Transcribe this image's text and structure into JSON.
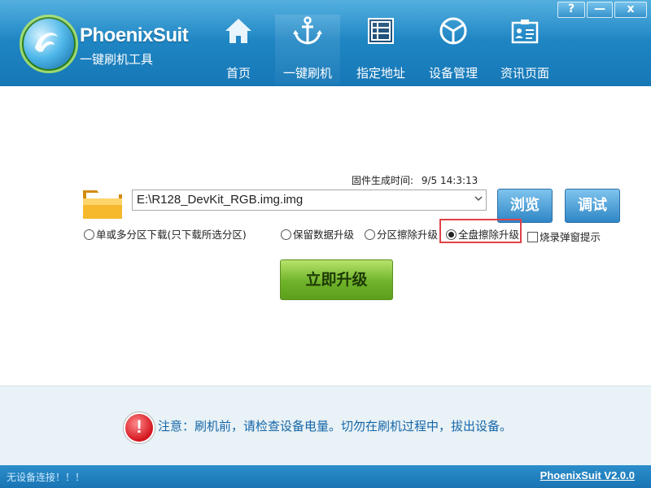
{
  "app": {
    "title": "PhoenixSuit",
    "subtitle": "一键刷机工具"
  },
  "window_controls": {
    "help": "?",
    "minimize": "—",
    "close": "x"
  },
  "nav": {
    "items": [
      {
        "label": "首页",
        "icon": "home-icon"
      },
      {
        "label": "一键刷机",
        "icon": "anchor-icon",
        "active": true
      },
      {
        "label": "指定地址",
        "icon": "grid-icon"
      },
      {
        "label": "设备管理",
        "icon": "device-icon"
      },
      {
        "label": "资讯页面",
        "icon": "news-icon"
      }
    ]
  },
  "firmware": {
    "time_label": "固件生成时间:",
    "time_value": "9/5 14:3:13",
    "path": "E:\\R128_DevKit_RGB.img.img",
    "browse_label": "浏览",
    "debug_label": "调试"
  },
  "options": {
    "single_partition": "单或多分区下载(只下载所选分区)",
    "keep_data": "保留数据升级",
    "partition_erase": "分区擦除升级",
    "full_erase": "全盘擦除升级",
    "selected": "full_erase",
    "popup_hint": "烧录弹窗提示",
    "popup_hint_checked": false
  },
  "upgrade_button": "立即升级",
  "notice": {
    "text": "注意：刷机前，请检查设备电量。切勿在刷机过程中，拔出设备。"
  },
  "status": {
    "left": "无设备连接！！！",
    "right": "PhoenixSuit V2.0.0"
  },
  "colors": {
    "header": "#1f86c4",
    "accent_red": "#e0424a",
    "upgrade_green": "#6fb32a"
  }
}
